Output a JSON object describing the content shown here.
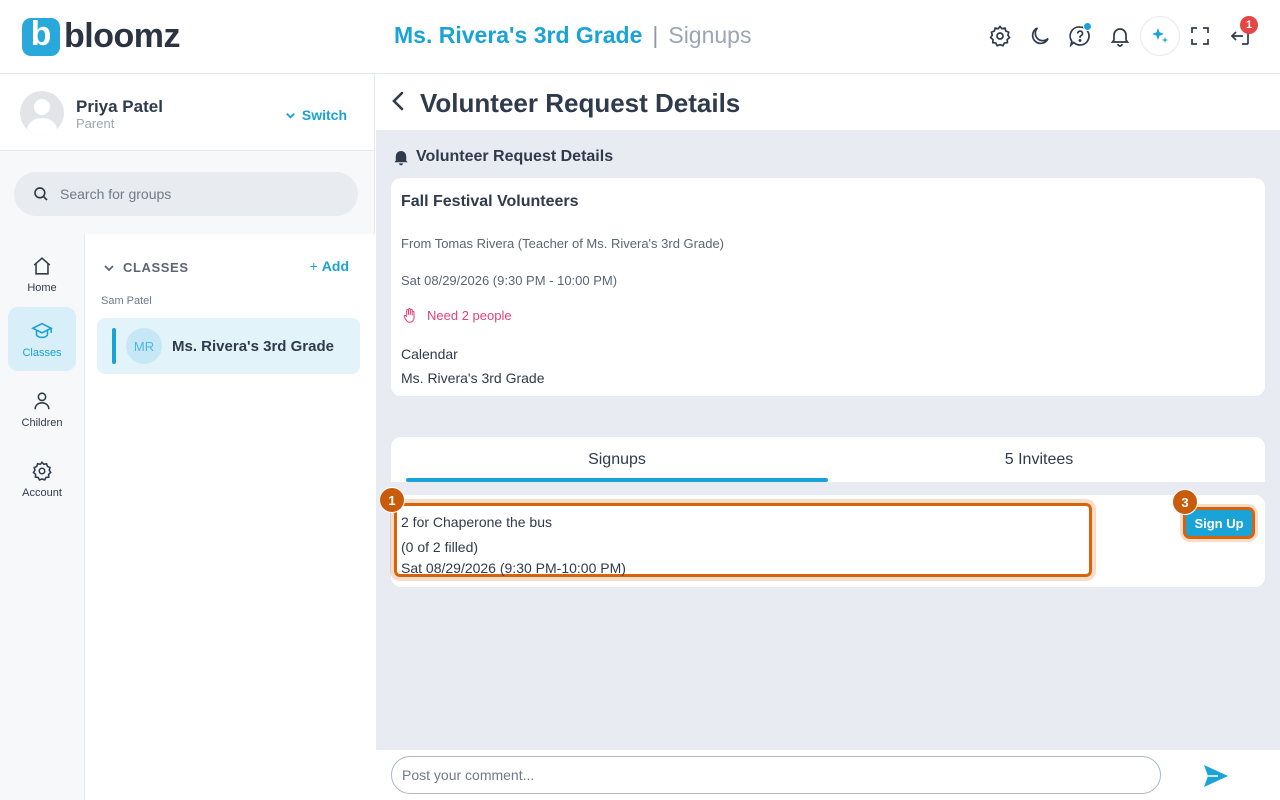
{
  "app": {
    "logo_letter": "b",
    "logo_text": "bloomz"
  },
  "header": {
    "group_name": "Ms. Rivera's 3rd Grade",
    "separator": "|",
    "page_name": "Signups",
    "icons": [
      "gear-icon",
      "moon-icon",
      "help-chat-icon",
      "bell-icon",
      "sparkle-icon",
      "fullscreen-icon",
      "logout-icon"
    ],
    "notification_count": "1"
  },
  "profile": {
    "name": "Priya Patel",
    "role": "Parent",
    "switch_label": "Switch"
  },
  "search": {
    "placeholder": "Search for groups"
  },
  "nav": {
    "items": [
      {
        "label": "Home",
        "icon": "home-icon"
      },
      {
        "label": "Classes",
        "icon": "graduation-cap-icon",
        "active": true
      },
      {
        "label": "Children",
        "icon": "person-icon"
      },
      {
        "label": "Account",
        "icon": "gear-icon"
      }
    ]
  },
  "groups": {
    "section_label": "CLASSES",
    "add_label": "Add",
    "child_label": "Sam Patel",
    "items": [
      {
        "initials": "MR",
        "name": "Ms. Rivera's 3rd Grade"
      }
    ]
  },
  "main": {
    "page_title": "Volunteer Request Details",
    "section_label": "Volunteer Request Details",
    "detail": {
      "title": "Fall Festival Volunteers",
      "from": "From Tomas Rivera (Teacher of Ms. Rivera's 3rd Grade)",
      "date": "Sat 08/29/2026 (9:30 PM - 10:00 PM)",
      "need": "Need 2 people",
      "calendar_label": "Calendar",
      "calendar_value": "Ms. Rivera's 3rd Grade"
    },
    "tabs": [
      {
        "label": "Signups",
        "active": true
      },
      {
        "label": "5 Invitees"
      }
    ],
    "slot": {
      "line1": "2 for Chaperone the bus",
      "line2": "(0 of 2 filled)",
      "line3": "Sat 08/29/2026 (9:30 PM-10:00 PM)",
      "marker_1": "1",
      "marker_3": "3",
      "signup_label": "Sign Up"
    },
    "comment_placeholder": "Post your comment..."
  },
  "colors": {
    "accent": "#1aa3d6",
    "highlight": "#d9620a",
    "need": "#e5417a"
  }
}
